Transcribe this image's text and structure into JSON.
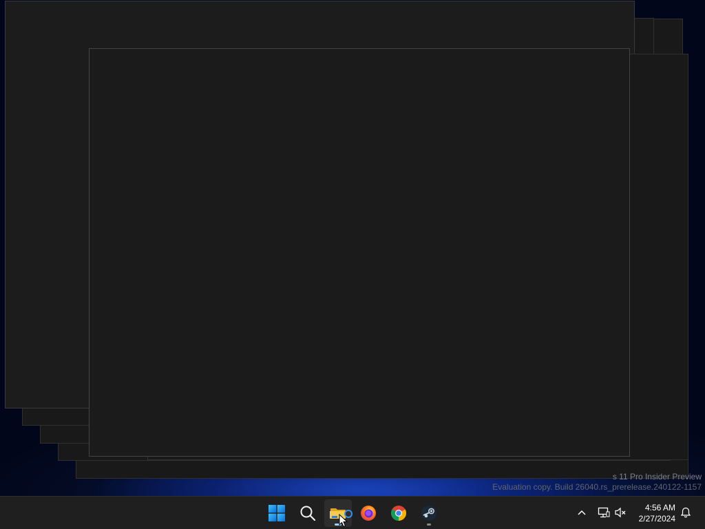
{
  "watermark": {
    "line1": "s 11 Pro Insider Preview",
    "line2": "Evaluation copy. Build 26040.rs_prerelease.240122-1157"
  },
  "taskbar": {
    "apps": [
      {
        "name": "Start",
        "icon": "windows-logo-icon"
      },
      {
        "name": "Search",
        "icon": "search-icon"
      },
      {
        "name": "File Explorer",
        "icon": "folder-icon",
        "active": true
      },
      {
        "name": "Firefox",
        "icon": "firefox-icon"
      },
      {
        "name": "Google Chrome",
        "icon": "chrome-icon"
      },
      {
        "name": "Steam",
        "icon": "steam-icon",
        "running": true
      }
    ],
    "tray": {
      "show_hidden_icon": "chevron-up-icon",
      "network_icon": "network-icon",
      "volume_icon": "volume-muted-icon",
      "notification_icon": "bell-icon"
    },
    "clock": {
      "time": "4:56 AM",
      "date": "2/27/2024"
    }
  },
  "colors": {
    "taskbar_bg": "#1f1f1f",
    "window_bg": "#1b1b1b",
    "accent_blue": "#0078d4",
    "folder_yellow": "#f4c542"
  }
}
